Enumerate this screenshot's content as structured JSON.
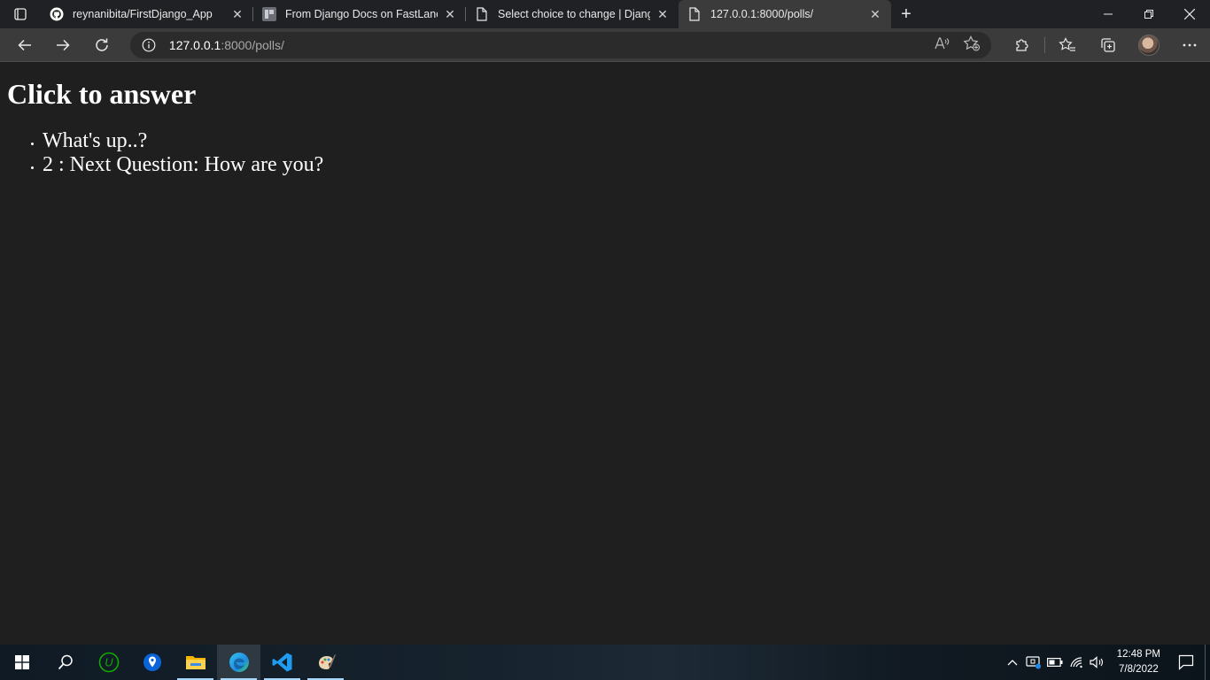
{
  "browser": {
    "tabs": [
      {
        "title": "reynanibita/FirstDjango_App",
        "icon": "github-icon",
        "active": false
      },
      {
        "title": "From Django Docs on FastLane T",
        "icon": "site-favicon-icon",
        "active": false
      },
      {
        "title": "Select choice to change | Django",
        "icon": "page-icon",
        "active": false
      },
      {
        "title": "127.0.0.1:8000/polls/",
        "icon": "page-icon",
        "active": true
      }
    ],
    "address": {
      "host": "127.0.0.1",
      "rest": ":8000/polls/"
    }
  },
  "page": {
    "heading": "Click to answer",
    "questions": [
      "What's up..?",
      "2 : Next Question: How are you?"
    ]
  },
  "taskbar": {
    "apps": [
      "windows-start-icon",
      "search-icon",
      "upwork-icon",
      "maps-icon",
      "file-explorer-icon",
      "edge-icon",
      "vscode-icon",
      "paint-icon"
    ],
    "time": "12:48 PM",
    "date": "7/8/2022"
  },
  "colors": {
    "page_bg": "#1f1f1f",
    "toolbar_bg": "#3b3b3b",
    "tabstrip_bg": "#202124"
  }
}
